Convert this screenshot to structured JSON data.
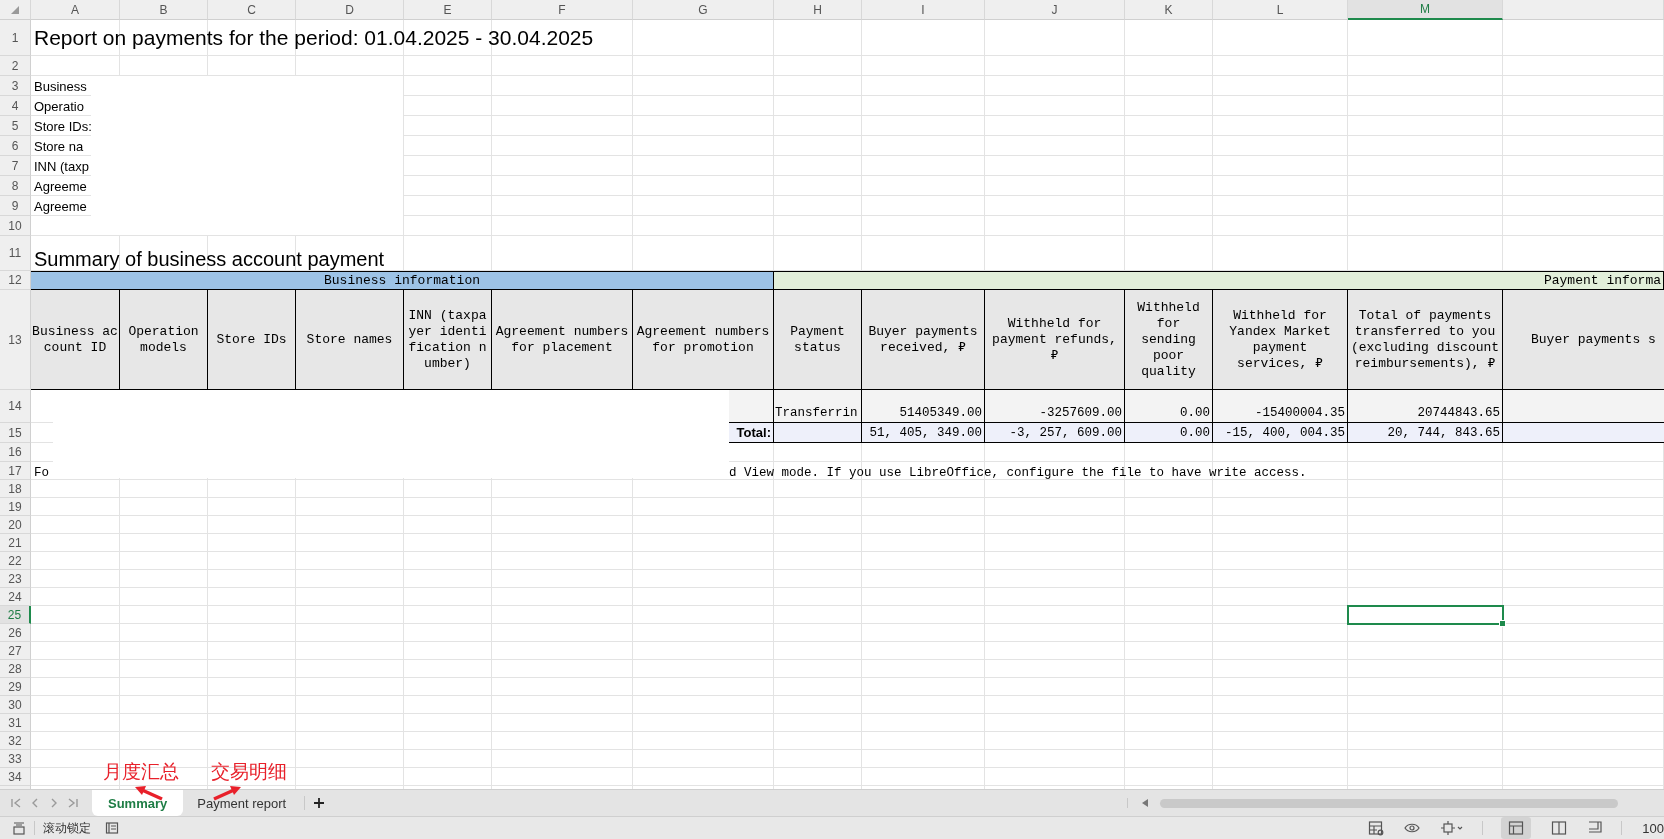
{
  "column_headers": [
    {
      "label": "A",
      "selected": false
    },
    {
      "label": "B",
      "selected": false
    },
    {
      "label": "C",
      "selected": false
    },
    {
      "label": "D",
      "selected": false
    },
    {
      "label": "E",
      "selected": false
    },
    {
      "label": "F",
      "selected": false
    },
    {
      "label": "G",
      "selected": false
    },
    {
      "label": "H",
      "selected": false
    },
    {
      "label": "I",
      "selected": false
    },
    {
      "label": "J",
      "selected": false
    },
    {
      "label": "K",
      "selected": false
    },
    {
      "label": "L",
      "selected": false
    },
    {
      "label": "M",
      "selected": true
    }
  ],
  "row_numbers": [
    {
      "label": "1",
      "selected": false
    },
    {
      "label": "2",
      "selected": false
    },
    {
      "label": "3",
      "selected": false
    },
    {
      "label": "4",
      "selected": false
    },
    {
      "label": "5",
      "selected": false
    },
    {
      "label": "6",
      "selected": false
    },
    {
      "label": "7",
      "selected": false
    },
    {
      "label": "8",
      "selected": false
    },
    {
      "label": "9",
      "selected": false
    },
    {
      "label": "10",
      "selected": false
    },
    {
      "label": "11",
      "selected": false
    },
    {
      "label": "12",
      "selected": false
    },
    {
      "label": "13",
      "selected": false
    },
    {
      "label": "14",
      "selected": false
    },
    {
      "label": "15",
      "selected": false
    },
    {
      "label": "16",
      "selected": false
    },
    {
      "label": "17",
      "selected": false
    },
    {
      "label": "18",
      "selected": false
    },
    {
      "label": "19",
      "selected": false
    },
    {
      "label": "20",
      "selected": false
    },
    {
      "label": "21",
      "selected": false
    },
    {
      "label": "22",
      "selected": false
    },
    {
      "label": "23",
      "selected": false
    },
    {
      "label": "24",
      "selected": false
    },
    {
      "label": "25",
      "selected": true
    },
    {
      "label": "26",
      "selected": false
    },
    {
      "label": "27",
      "selected": false
    },
    {
      "label": "28",
      "selected": false
    },
    {
      "label": "29",
      "selected": false
    },
    {
      "label": "30",
      "selected": false
    },
    {
      "label": "31",
      "selected": false
    },
    {
      "label": "32",
      "selected": false
    },
    {
      "label": "33",
      "selected": false
    },
    {
      "label": "34",
      "selected": false
    }
  ],
  "report_title": "Report on payments for the period: 01.04.2025 - 30.04.2025",
  "info_labels": [
    "Business",
    "Operatio",
    "Store IDs:",
    "Store na",
    "INN (taxp",
    "Agreeme",
    "Agreeme"
  ],
  "summary_title": "Summary of business account payment",
  "table": {
    "group_headers": [
      {
        "label": "Business information",
        "kind": "business"
      },
      {
        "label": "Payment informa",
        "kind": "payment"
      }
    ],
    "columns": [
      "Business account ID",
      "Operation models",
      "Store IDs",
      "Store names",
      "INN (taxpayer identification number)",
      "Agreement numbers for placement",
      "Agreement numbers for promotion",
      "Payment status",
      "Buyer payments received, ₽",
      "Withheld for payment refunds, ₽",
      "Withheld for sending poor quality",
      "Withheld for Yandex Market payment services, ₽",
      "Total of payments transferred to you (excluding discount reimbursements), ₽",
      "Buyer payments s"
    ],
    "rows": [
      {
        "kind": "data",
        "cells": [
          "",
          "",
          "",
          "",
          "",
          "",
          "",
          "Transferrin",
          "51405349.00",
          "-3257609.00",
          "0.00",
          "-15400004.35",
          "20744843.65"
        ]
      },
      {
        "kind": "total",
        "cells": [
          "",
          "",
          "",
          "",
          "",
          "",
          "Total:",
          "",
          "51, 405, 349.00",
          "-3, 257, 609.00",
          "0.00",
          "-15, 400, 004.35",
          "20, 744, 843.65"
        ]
      }
    ]
  },
  "note_parts": [
    "Fo",
    "d View mode. If you use LibreOffice, configure the file to have write access."
  ],
  "sheet_tabs": [
    {
      "label": "Summary",
      "selected": true
    },
    {
      "label": "Payment report",
      "selected": false
    }
  ],
  "annotations": [
    {
      "label": "月度汇总"
    },
    {
      "label": "交易明细"
    }
  ],
  "status_bar": {
    "scroll_lock": "滚动锁定",
    "zoom": "100"
  }
}
